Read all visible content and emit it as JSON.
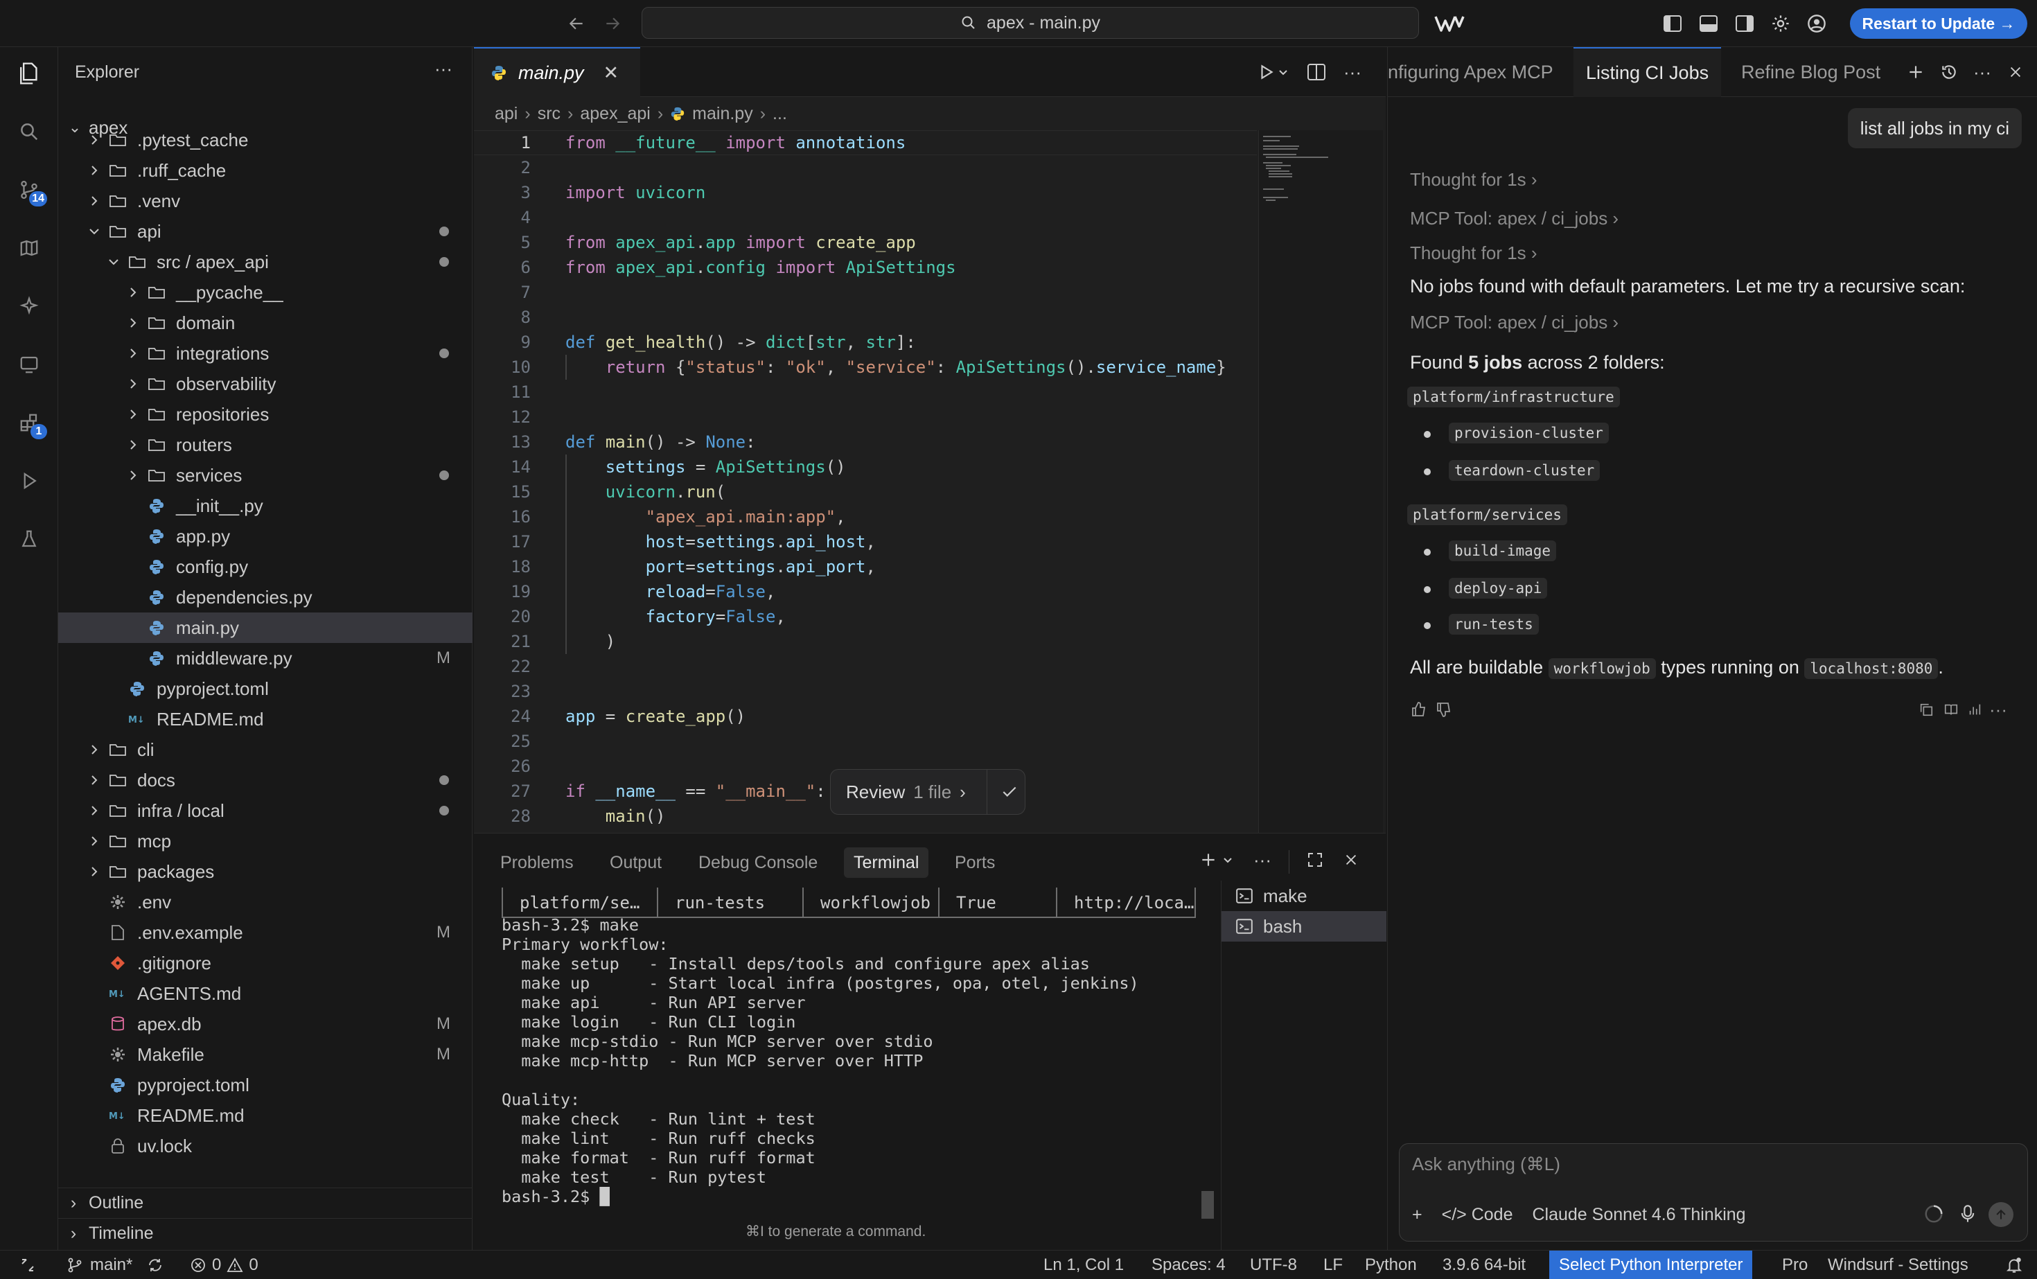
{
  "titlebar": {
    "search_text": "apex - main.py",
    "restart_label": "Restart to Update →"
  },
  "activity": {
    "scm_badge": "14",
    "extensions_badge": "1"
  },
  "explorer": {
    "title": "Explorer",
    "root": "apex",
    "rows": [
      {
        "label": ".pytest_cache",
        "depth": 1,
        "type": "folder",
        "chev": "›",
        "dec": ""
      },
      {
        "label": ".ruff_cache",
        "depth": 1,
        "type": "folder",
        "chev": "›",
        "dec": ""
      },
      {
        "label": ".venv",
        "depth": 1,
        "type": "folder",
        "chev": "›",
        "dec": ""
      },
      {
        "label": "api",
        "depth": 1,
        "type": "folder-open",
        "chev": "⌄",
        "dec": "dot"
      },
      {
        "label": "src / apex_api",
        "depth": 2,
        "type": "folder-open",
        "chev": "⌄",
        "dec": "dot"
      },
      {
        "label": "__pycache__",
        "depth": 3,
        "type": "folder",
        "chev": "›",
        "dec": ""
      },
      {
        "label": "domain",
        "depth": 3,
        "type": "folder",
        "chev": "›",
        "dec": ""
      },
      {
        "label": "integrations",
        "depth": 3,
        "type": "folder",
        "chev": "›",
        "dec": "dot"
      },
      {
        "label": "observability",
        "depth": 3,
        "type": "folder",
        "chev": "›",
        "dec": ""
      },
      {
        "label": "repositories",
        "depth": 3,
        "type": "folder",
        "chev": "›",
        "dec": ""
      },
      {
        "label": "routers",
        "depth": 3,
        "type": "folder",
        "chev": "›",
        "dec": ""
      },
      {
        "label": "services",
        "depth": 3,
        "type": "folder",
        "chev": "›",
        "dec": "dot"
      },
      {
        "label": "__init__.py",
        "depth": 3,
        "type": "python",
        "chev": "",
        "dec": ""
      },
      {
        "label": "app.py",
        "depth": 3,
        "type": "python",
        "chev": "",
        "dec": ""
      },
      {
        "label": "config.py",
        "depth": 3,
        "type": "python",
        "chev": "",
        "dec": ""
      },
      {
        "label": "dependencies.py",
        "depth": 3,
        "type": "python",
        "chev": "",
        "dec": ""
      },
      {
        "label": "main.py",
        "depth": 3,
        "type": "python",
        "chev": "",
        "dec": "",
        "selected": true
      },
      {
        "label": "middleware.py",
        "depth": 3,
        "type": "python",
        "chev": "",
        "dec": "M"
      },
      {
        "label": "pyproject.toml",
        "depth": 2,
        "type": "python",
        "chev": "",
        "dec": ""
      },
      {
        "label": "README.md",
        "depth": 2,
        "type": "md",
        "chev": "",
        "dec": ""
      },
      {
        "label": "cli",
        "depth": 1,
        "type": "folder",
        "chev": "›",
        "dec": ""
      },
      {
        "label": "docs",
        "depth": 1,
        "type": "folder",
        "chev": "›",
        "dec": "dot"
      },
      {
        "label": "infra / local",
        "depth": 1,
        "type": "folder",
        "chev": "›",
        "dec": "dot"
      },
      {
        "label": "mcp",
        "depth": 1,
        "type": "folder",
        "chev": "›",
        "dec": ""
      },
      {
        "label": "packages",
        "depth": 1,
        "type": "folder",
        "chev": "›",
        "dec": ""
      },
      {
        "label": ".env",
        "depth": 1,
        "type": "gear",
        "chev": "",
        "dec": ""
      },
      {
        "label": ".env.example",
        "depth": 1,
        "type": "file",
        "chev": "",
        "dec": "M"
      },
      {
        "label": ".gitignore",
        "depth": 1,
        "type": "git",
        "chev": "",
        "dec": ""
      },
      {
        "label": "AGENTS.md",
        "depth": 1,
        "type": "md",
        "chev": "",
        "dec": ""
      },
      {
        "label": "apex.db",
        "depth": 1,
        "type": "db",
        "chev": "",
        "dec": "M"
      },
      {
        "label": "Makefile",
        "depth": 1,
        "type": "gear",
        "chev": "",
        "dec": "M"
      },
      {
        "label": "pyproject.toml",
        "depth": 1,
        "type": "python",
        "chev": "",
        "dec": ""
      },
      {
        "label": "README.md",
        "depth": 1,
        "type": "md",
        "chev": "",
        "dec": ""
      },
      {
        "label": "uv.lock",
        "depth": 1,
        "type": "lock",
        "chev": "",
        "dec": ""
      }
    ],
    "outline_label": "Outline",
    "timeline_label": "Timeline"
  },
  "editor": {
    "tab_label": "main.py",
    "breadcrumb": [
      "api",
      "src",
      "apex_api",
      "main.py",
      "..."
    ],
    "review_label": "Review",
    "review_count": "1 file"
  },
  "panel": {
    "tabs": [
      "Problems",
      "Output",
      "Debug Console",
      "Terminal",
      "Ports"
    ],
    "active_tab": "Terminal",
    "table_row": [
      "platform/se…",
      "run-tests",
      "workflowjob",
      "True",
      "http://loca…"
    ],
    "terminal_text": "bash-3.2$ make\nPrimary workflow:\n  make setup   - Install deps/tools and configure apex alias\n  make up      - Start local infra (postgres, opa, otel, jenkins)\n  make api     - Run API server\n  make login   - Run CLI login\n  make mcp-stdio - Run MCP server over stdio\n  make mcp-http  - Run MCP server over HTTP\n\nQuality:\n  make check   - Run lint + test\n  make lint    - Run ruff checks\n  make format  - Run ruff format\n  make test    - Run pytest\nbash-3.2$ █",
    "terminals": [
      "make",
      "bash"
    ],
    "hint": "⌘I to generate a command."
  },
  "chat": {
    "tabs": [
      "nfiguring Apex MCP",
      "Listing CI Jobs",
      "Refine Blog Post"
    ],
    "active_tab": "Listing CI Jobs",
    "user_message": "list all jobs in my ci",
    "thought1": "Thought for 1s",
    "tool1": "MCP Tool: apex / ci_jobs",
    "thought2": "Thought for 1s",
    "no_jobs": "No jobs found with default parameters. Let me try a recursive scan:",
    "tool2": "MCP Tool: apex / ci_jobs",
    "found_prefix": "Found ",
    "found_bold": "5 jobs",
    "found_suffix": " across 2 folders:",
    "folder1": "platform/infrastructure",
    "folder1_jobs": [
      "provision-cluster",
      "teardown-cluster"
    ],
    "folder2": "platform/services",
    "folder2_jobs": [
      "build-image",
      "deploy-api",
      "run-tests"
    ],
    "summary_a": "All are buildable ",
    "summary_chip1": "workflowjob",
    "summary_b": " types running on ",
    "summary_chip2": "localhost:8080",
    "summary_c": ".",
    "input_placeholder": "Ask anything (⌘L)",
    "code_label": "Code",
    "model_label": "Claude Sonnet 4.6 Thinking"
  },
  "statusbar": {
    "branch": "main*",
    "errors": "0",
    "warnings": "0",
    "position": "Ln 1, Col 1",
    "spaces": "Spaces: 4",
    "encoding": "UTF-8",
    "eol": "LF",
    "language": "Python",
    "version": "3.9.6 64-bit",
    "interpreter": "Select Python Interpreter",
    "plan": "Pro",
    "settings": "Windsurf - Settings"
  },
  "colors": {
    "accent": "#2d6fd6",
    "background": "#181818",
    "editor_bg": "#1f1f1f"
  }
}
